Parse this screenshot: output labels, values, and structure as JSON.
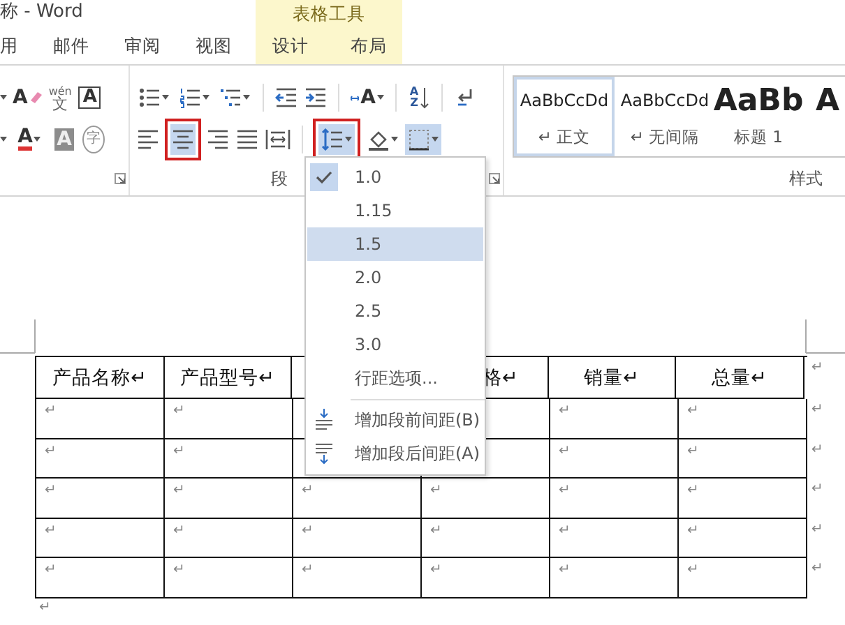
{
  "window": {
    "title": "称 - Word"
  },
  "tabs": [
    {
      "label": "用",
      "selected": false
    },
    {
      "label": "邮件",
      "selected": false
    },
    {
      "label": "审阅",
      "selected": false
    },
    {
      "label": "视图",
      "selected": false
    }
  ],
  "contextual_tab_group": {
    "title": "表格工具",
    "tabs": [
      {
        "label": "设计",
        "selected": false
      },
      {
        "label": "布局",
        "selected": false
      }
    ]
  },
  "font_group": {
    "rows": [
      [
        {
          "kind": "caret"
        },
        {
          "kind": "clear-format",
          "glyph": "A"
        },
        {
          "kind": "phonetic",
          "ruby": "wén",
          "glyph": "文"
        },
        {
          "kind": "char-border",
          "glyph": "A"
        }
      ],
      [
        {
          "kind": "caret"
        },
        {
          "kind": "font-color",
          "glyph": "A",
          "dropdown": true
        },
        {
          "kind": "char-shading",
          "glyph": "A"
        },
        {
          "kind": "enclosed-char",
          "glyph": "字"
        }
      ]
    ]
  },
  "paragraph_group": {
    "label": "段",
    "rows": [
      [
        {
          "kind": "bullets",
          "dropdown": true
        },
        {
          "kind": "numbering",
          "dropdown": true
        },
        {
          "kind": "multilevel",
          "dropdown": true
        },
        {
          "kind": "decrease-indent",
          "divider_before": true
        },
        {
          "kind": "increase-indent"
        },
        {
          "kind": "char-scaling",
          "glyph": "A",
          "dropdown": true,
          "divider_before": true
        },
        {
          "kind": "sort",
          "glyph": "A",
          "glyph_2": "Z",
          "divider_before": true
        },
        {
          "kind": "show-marks",
          "divider_before": true
        }
      ],
      [
        {
          "kind": "align-left",
          "selected": false
        },
        {
          "kind": "align-center",
          "selected": true,
          "marked": true
        },
        {
          "kind": "align-right",
          "selected": false
        },
        {
          "kind": "justify",
          "selected": false
        },
        {
          "kind": "distribute",
          "selected": false
        },
        {
          "kind": "line-spacing",
          "selected": true,
          "marked": true,
          "dropdown": true,
          "divider_before": true
        },
        {
          "kind": "shading",
          "selected": false,
          "dropdown": true
        },
        {
          "kind": "borders",
          "selected": true,
          "dropdown": true
        }
      ]
    ]
  },
  "styles_group": {
    "label": "样式",
    "styles": [
      {
        "kind": "body",
        "sample": "AaBbCcDd",
        "label": "↵ 正文",
        "selected": true
      },
      {
        "kind": "body",
        "sample": "AaBbCcDd",
        "label": "↵ 无间隔",
        "selected": false
      },
      {
        "kind": "heading",
        "sample": "AaBb",
        "label": "标题 1",
        "selected": false
      },
      {
        "kind": "heading",
        "sample": "A",
        "selected": false
      }
    ]
  },
  "line_spacing_menu": {
    "items": [
      {
        "kind": "option",
        "label": "1.0",
        "selected": true,
        "highlighted": false
      },
      {
        "kind": "option",
        "label": "1.15",
        "selected": false,
        "highlighted": false
      },
      {
        "kind": "option",
        "label": "1.5",
        "selected": false,
        "highlighted": true
      },
      {
        "kind": "option",
        "label": "2.0",
        "selected": false,
        "highlighted": false
      },
      {
        "kind": "option",
        "label": "2.5",
        "selected": false,
        "highlighted": false
      },
      {
        "kind": "option",
        "label": "3.0",
        "selected": false,
        "highlighted": false
      },
      {
        "kind": "option",
        "label": "行距选项...",
        "selected": false,
        "highlighted": false
      },
      {
        "kind": "space-before",
        "label": "增加段前间距(B)",
        "highlighted": false
      },
      {
        "kind": "space-after",
        "label": "增加段后间距(A)",
        "highlighted": false
      }
    ]
  },
  "table": {
    "rows": [
      {
        "kind": "header",
        "end_mark": "↵",
        "cells": [
          {
            "text": "产品名称↵"
          },
          {
            "text": "产品型号↵"
          },
          {},
          {
            "text": "格↵"
          },
          {
            "text": "销量↵"
          },
          {
            "text": "总量↵"
          }
        ]
      },
      {
        "kind": "body",
        "end_mark": "↵",
        "cells": [
          {
            "text": "↵"
          },
          {
            "text": "↵"
          },
          {},
          {},
          {
            "text": "↵"
          },
          {
            "text": "↵"
          }
        ]
      },
      {
        "kind": "body",
        "end_mark": "↵",
        "cells": [
          {
            "text": "↵"
          },
          {
            "text": "↵"
          },
          {},
          {},
          {
            "text": "↵"
          },
          {
            "text": "↵"
          }
        ]
      },
      {
        "kind": "body",
        "end_mark": "↵",
        "cells": [
          {
            "text": "↵"
          },
          {
            "text": "↵"
          },
          {
            "text": "↵"
          },
          {
            "text": "↵"
          },
          {
            "text": "↵"
          },
          {
            "text": "↵"
          }
        ]
      },
      {
        "kind": "body",
        "end_mark": "↵",
        "cells": [
          {
            "text": "↵"
          },
          {
            "text": "↵"
          },
          {
            "text": "↵"
          },
          {
            "text": "↵"
          },
          {
            "text": "↵"
          },
          {
            "text": "↵"
          }
        ]
      },
      {
        "kind": "body",
        "end_mark": "↵",
        "cells": [
          {
            "text": "↵"
          },
          {
            "text": "↵"
          },
          {
            "text": "↵"
          },
          {
            "text": "↵"
          },
          {
            "text": "↵"
          },
          {
            "text": "↵"
          }
        ]
      }
    ]
  },
  "after_table_mark": "↵"
}
